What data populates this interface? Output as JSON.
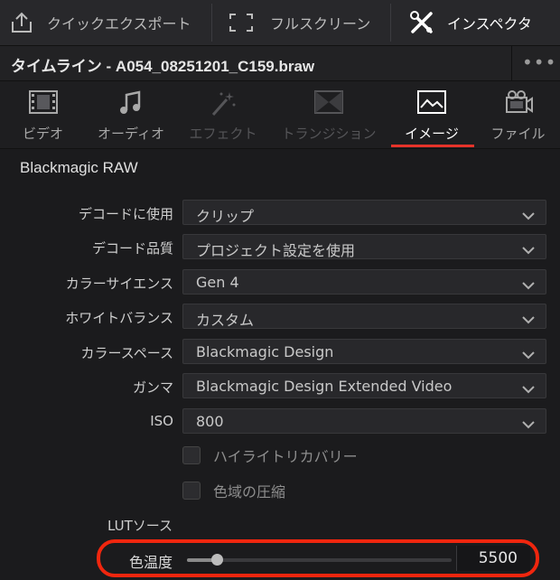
{
  "toolbar": {
    "quick_export": "クイックエクスポート",
    "fullscreen": "フルスクリーン",
    "inspector": "インスペクタ"
  },
  "titlebar": {
    "title": "タイムライン - A054_08251201_C159.braw",
    "more": "•••"
  },
  "tabs": [
    {
      "label": "ビデオ",
      "icon": "film-icon",
      "state": "normal"
    },
    {
      "label": "オーディオ",
      "icon": "music-note-icon",
      "state": "normal"
    },
    {
      "label": "エフェクト",
      "icon": "magic-wand-icon",
      "state": "disabled"
    },
    {
      "label": "トランジション",
      "icon": "transition-icon",
      "state": "disabled"
    },
    {
      "label": "イメージ",
      "icon": "image-icon",
      "state": "active"
    },
    {
      "label": "ファイル",
      "icon": "camera-file-icon",
      "state": "normal"
    }
  ],
  "section": {
    "title": "Blackmagic RAW"
  },
  "settings": [
    {
      "label": "デコードに使用",
      "value": "クリップ"
    },
    {
      "label": "デコード品質",
      "value": "プロジェクト設定を使用"
    },
    {
      "label": "カラーサイエンス",
      "value": "Gen 4"
    },
    {
      "label": "ホワイトバランス",
      "value": "カスタム"
    },
    {
      "label": "カラースペース",
      "value": "Blackmagic Design"
    },
    {
      "label": "ガンマ",
      "value": "Blackmagic Design Extended Video"
    },
    {
      "label": "ISO",
      "value": "800"
    }
  ],
  "checkboxes": [
    {
      "label": "ハイライトリカバリー",
      "checked": false
    },
    {
      "label": "色域の圧縮",
      "checked": false
    }
  ],
  "lut": {
    "label": "LUTソース"
  },
  "color_temp": {
    "label": "色温度",
    "value": "5500",
    "slider_fraction": 0.08
  },
  "colors": {
    "accent": "#e6332a",
    "highlight": "#f0260e",
    "background": "#1b1b1d"
  }
}
